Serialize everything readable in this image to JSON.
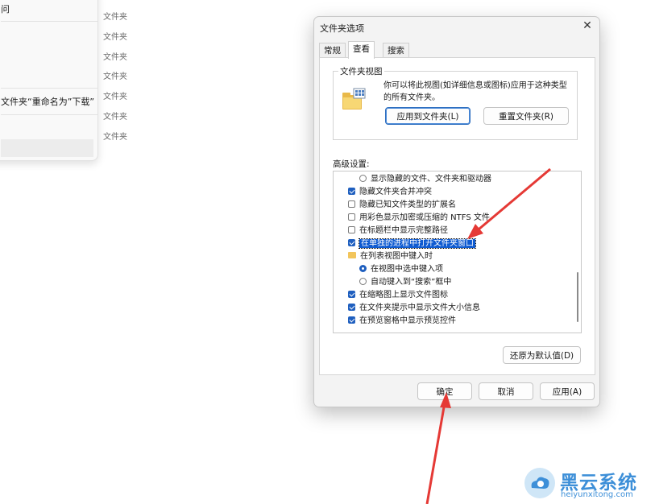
{
  "background": {
    "menu_items": [
      "问",
      "文件夹“重命名为”下载”"
    ],
    "type_column": [
      "文件夹",
      "文件夹",
      "文件夹",
      "文件夹",
      "文件夹",
      "文件夹",
      "文件夹"
    ]
  },
  "dialog": {
    "title": "文件夹选项",
    "tabs": [
      "常规",
      "查看",
      "搜索"
    ],
    "active_tab": "查看",
    "folder_view": {
      "label": "文件夹视图",
      "description": "你可以将此视图(如详细信息或图标)应用于这种类型的所有文件夹。",
      "apply_button": "应用到文件夹(L)",
      "reset_button": "重置文件夹(R)"
    },
    "advanced_label": "高级设置:",
    "advanced_items": [
      {
        "kind": "radio",
        "checked": false,
        "indent": 2,
        "text": "显示隐藏的文件、文件夹和驱动器"
      },
      {
        "kind": "checkbox",
        "checked": true,
        "indent": 1,
        "text": "隐藏文件夹合并冲突"
      },
      {
        "kind": "checkbox",
        "checked": false,
        "indent": 1,
        "text": "隐藏已知文件类型的扩展名"
      },
      {
        "kind": "checkbox",
        "checked": false,
        "indent": 1,
        "text": "用彩色显示加密或压缩的 NTFS 文件"
      },
      {
        "kind": "checkbox",
        "checked": false,
        "indent": 1,
        "text": "在标题栏中显示完整路径"
      },
      {
        "kind": "checkbox",
        "checked": true,
        "indent": 1,
        "text": "在单独的进程中打开文件夹窗口",
        "selected": true
      },
      {
        "kind": "folder",
        "checked": false,
        "indent": 1,
        "text": "在列表视图中键入时"
      },
      {
        "kind": "radio",
        "checked": true,
        "indent": 2,
        "text": "在视图中选中键入项"
      },
      {
        "kind": "radio",
        "checked": false,
        "indent": 2,
        "text": "自动键入到“搜索”框中"
      },
      {
        "kind": "checkbox",
        "checked": true,
        "indent": 1,
        "text": "在缩略图上显示文件图标"
      },
      {
        "kind": "checkbox",
        "checked": true,
        "indent": 1,
        "text": "在文件夹提示中显示文件大小信息"
      },
      {
        "kind": "checkbox",
        "checked": true,
        "indent": 1,
        "text": "在预览窗格中显示预览控件"
      }
    ],
    "restore_button": "还原为默认值(D)",
    "ok_button": "确定",
    "cancel_button": "取消",
    "apply_button": "应用(A)"
  },
  "watermark": {
    "title": "黑云系统",
    "url": "heiyunxitong.com"
  },
  "colors": {
    "accent": "#1f5fbf",
    "selection": "#0f5bd1",
    "annotation_arrow": "#e53935",
    "watermark": "#3d8fd8"
  }
}
